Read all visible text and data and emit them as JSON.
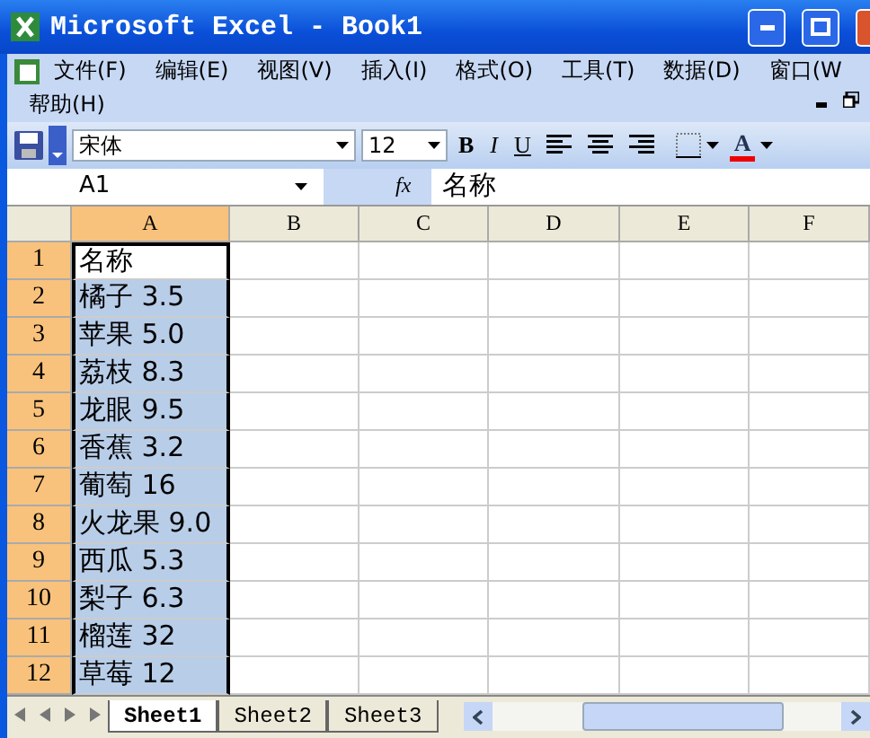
{
  "window": {
    "title": "Microsoft Excel - Book1"
  },
  "menu": {
    "items": [
      {
        "label": "文件(F)"
      },
      {
        "label": "编辑(E)"
      },
      {
        "label": "视图(V)"
      },
      {
        "label": "插入(I)"
      },
      {
        "label": "格式(O)"
      },
      {
        "label": "工具(T)"
      },
      {
        "label": "数据(D)"
      },
      {
        "label": "窗口(W"
      },
      {
        "label": "帮助(H)"
      }
    ]
  },
  "toolbar": {
    "font": "宋体",
    "size": "12",
    "bold": "B",
    "italic": "I",
    "underline": "U",
    "font_color": "A"
  },
  "formula_bar": {
    "name_box": "A1",
    "fx": "fx",
    "value": "名称"
  },
  "columns": [
    {
      "label": "A",
      "selected": true
    },
    {
      "label": "B",
      "selected": false
    },
    {
      "label": "C",
      "selected": false
    },
    {
      "label": "D",
      "selected": false
    },
    {
      "label": "E",
      "selected": false
    },
    {
      "label": "F",
      "selected": false
    }
  ],
  "rows": [
    {
      "number": "1",
      "value": "名称",
      "selected": true,
      "active": true
    },
    {
      "number": "2",
      "value": "橘子 3.5",
      "selected": true,
      "active": false
    },
    {
      "number": "3",
      "value": "苹果 5.0",
      "selected": true,
      "active": false
    },
    {
      "number": "4",
      "value": "荔枝 8.3",
      "selected": true,
      "active": false
    },
    {
      "number": "5",
      "value": "龙眼 9.5",
      "selected": true,
      "active": false
    },
    {
      "number": "6",
      "value": "香蕉 3.2",
      "selected": true,
      "active": false
    },
    {
      "number": "7",
      "value": "葡萄 16",
      "selected": true,
      "active": false
    },
    {
      "number": "8",
      "value": "火龙果 9.0",
      "selected": true,
      "active": false
    },
    {
      "number": "9",
      "value": "西瓜 5.3",
      "selected": true,
      "active": false
    },
    {
      "number": "10",
      "value": "梨子 6.3",
      "selected": true,
      "active": false
    },
    {
      "number": "11",
      "value": "榴莲 32",
      "selected": true,
      "active": false
    },
    {
      "number": "12",
      "value": "草莓 12",
      "selected": true,
      "active": false
    }
  ],
  "sheets": [
    {
      "label": "Sheet1",
      "selected": true
    },
    {
      "label": "Sheet2",
      "selected": false
    },
    {
      "label": "Sheet3",
      "selected": false
    }
  ]
}
